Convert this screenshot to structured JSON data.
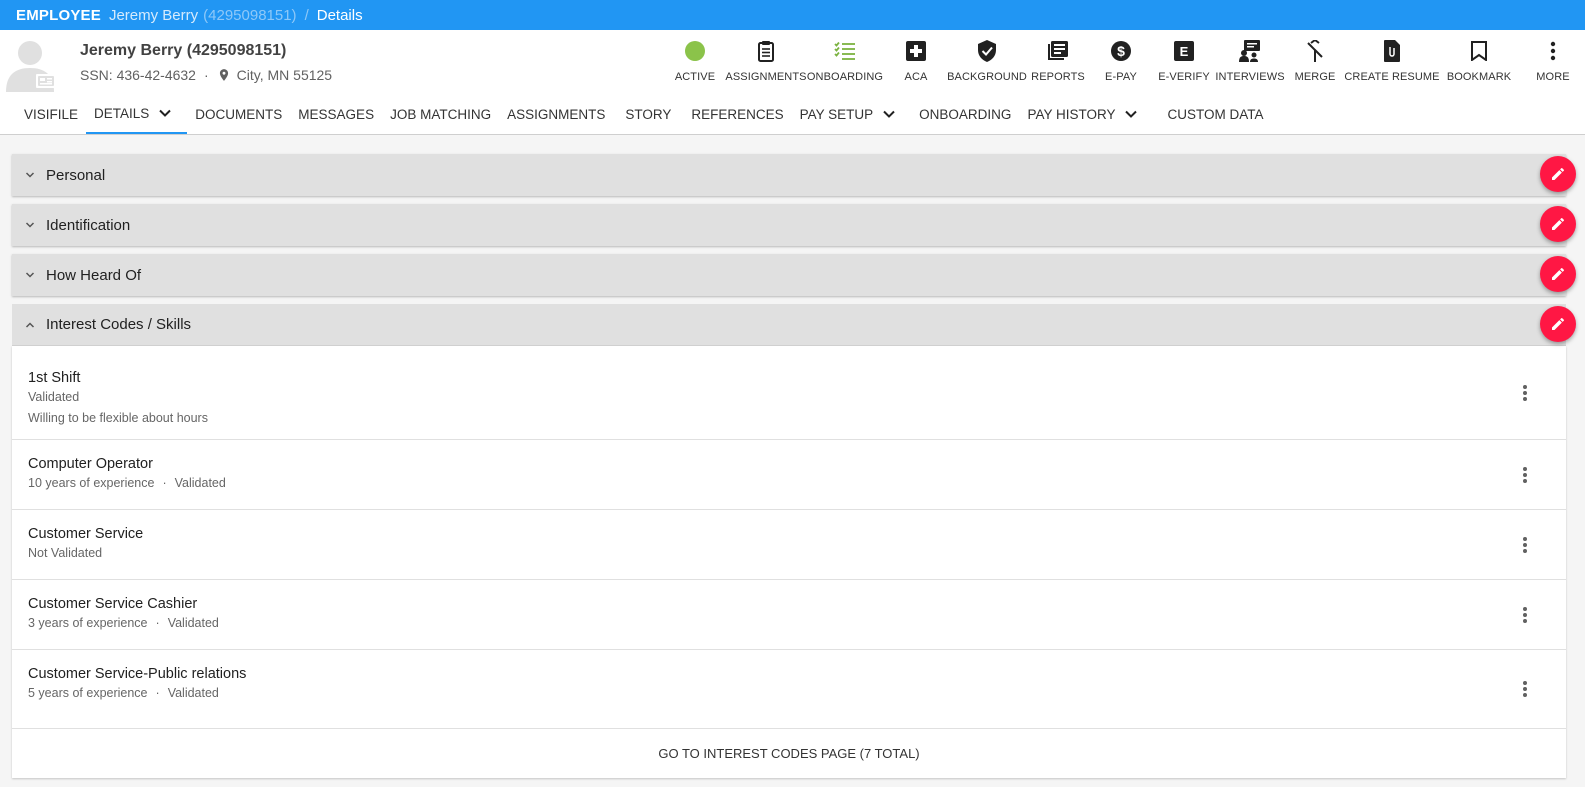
{
  "appbar": {
    "entity": "EMPLOYEE",
    "name": "Jeremy Berry",
    "id": "(4295098151)",
    "separator": "/",
    "crumb": "Details"
  },
  "employee": {
    "full_name": "Jeremy Berry (4295098151)",
    "ssn": "SSN: 436-42-4632",
    "dot": "·",
    "location": "City, MN 55125"
  },
  "colors": {
    "appbar": "#2196f3",
    "status_active": "#8bc34a",
    "onboarding_icon": "#7cb342",
    "fab": "#ff1744"
  },
  "actions": [
    {
      "label": "ACTIVE",
      "icon": "status-dot-icon"
    },
    {
      "label": "ASSIGNMENTS",
      "icon": "clipboard-icon"
    },
    {
      "label": "ONBOARDING",
      "icon": "checklist-icon"
    },
    {
      "label": "ACA",
      "icon": "medical-plus-icon"
    },
    {
      "label": "BACKGROUND",
      "icon": "shield-check-icon"
    },
    {
      "label": "REPORTS",
      "icon": "reports-icon"
    },
    {
      "label": "E-PAY",
      "icon": "dollar-icon"
    },
    {
      "label": "E-VERIFY",
      "icon": "e-verify-icon"
    },
    {
      "label": "INTERVIEWS",
      "icon": "interviews-icon"
    },
    {
      "label": "MERGE",
      "icon": "merge-icon"
    },
    {
      "label": "CREATE RESUME",
      "icon": "resume-icon"
    },
    {
      "label": "BOOKMARK",
      "icon": "bookmark-icon"
    },
    {
      "label": "MORE",
      "icon": "more-vertical-icon"
    }
  ],
  "tabs": [
    {
      "label": "VISIFILE"
    },
    {
      "label": "DETAILS",
      "active": true,
      "dropdown": true
    },
    {
      "label": "DOCUMENTS"
    },
    {
      "label": "MESSAGES"
    },
    {
      "label": "JOB MATCHING"
    },
    {
      "label": "ASSIGNMENTS"
    },
    {
      "label": "STORY"
    },
    {
      "label": "REFERENCES"
    },
    {
      "label": "PAY SETUP",
      "dropdown": true
    },
    {
      "label": "ONBOARDING"
    },
    {
      "label": "PAY HISTORY",
      "dropdown": true
    },
    {
      "label": "CUSTOM DATA"
    }
  ],
  "panels": [
    {
      "title": "Personal",
      "expanded": false
    },
    {
      "title": "Identification",
      "expanded": false
    },
    {
      "title": "How Heard Of",
      "expanded": false
    },
    {
      "title": "Interest Codes / Skills",
      "expanded": true
    }
  ],
  "interest_codes": {
    "items": [
      {
        "title": "1st Shift",
        "status": "Validated",
        "note": "Willing to be flexible about hours"
      },
      {
        "title": "Computer Operator",
        "experience": "10 years of experience",
        "status": "Validated"
      },
      {
        "title": "Customer Service",
        "status": "Not Validated"
      },
      {
        "title": "Customer Service Cashier",
        "experience": "3 years of experience",
        "status": "Validated"
      },
      {
        "title": "Customer Service-Public relations",
        "experience": "5 years of experience",
        "status": "Validated"
      }
    ],
    "footer_label": "GO TO INTEREST CODES PAGE (7 TOTAL)"
  }
}
